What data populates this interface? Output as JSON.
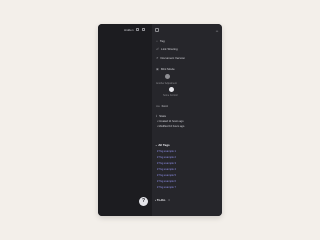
{
  "left": {
    "title": "Hidden",
    "help_label": "?"
  },
  "topbar": {
    "menu_icon": "sidebar-icon",
    "more_label": "•••"
  },
  "sidebar": {
    "items": [
      {
        "label": "Tag",
        "icon": "tag-icon",
        "glyph": "⌂"
      },
      {
        "label": "Link Sharing",
        "icon": "link-icon",
        "glyph": "☍"
      },
      {
        "label": "Document Version",
        "icon": "history-icon",
        "glyph": "↺"
      },
      {
        "label": "Mini Mode",
        "icon": "mini-icon",
        "glyph": "▣"
      }
    ],
    "toggles": [
      {
        "caption": "Another Adjustment"
      },
      {
        "caption": "Some Control"
      }
    ],
    "font_label": "Font",
    "font_glyph": "Aa",
    "stats_label": "Stats",
    "stats_glyph": "ℹ",
    "stats_lines": [
      "Created 11 hours ago",
      "Modified 10 hours ago"
    ],
    "all_tags_label": "All Tags",
    "tags": [
      "Tag example 1",
      "Tag example 2",
      "Tag example 3",
      "Tag example 4",
      "Tag example 5",
      "Tag example 6",
      "Tag example 7"
    ],
    "todo_label": "To-Do",
    "todo_count": "3"
  },
  "colors": {
    "page_bg": "#f3efea",
    "panel_bg": "#26262b",
    "left_bg": "#1c1c20",
    "tag_color": "#8e8ee8"
  }
}
